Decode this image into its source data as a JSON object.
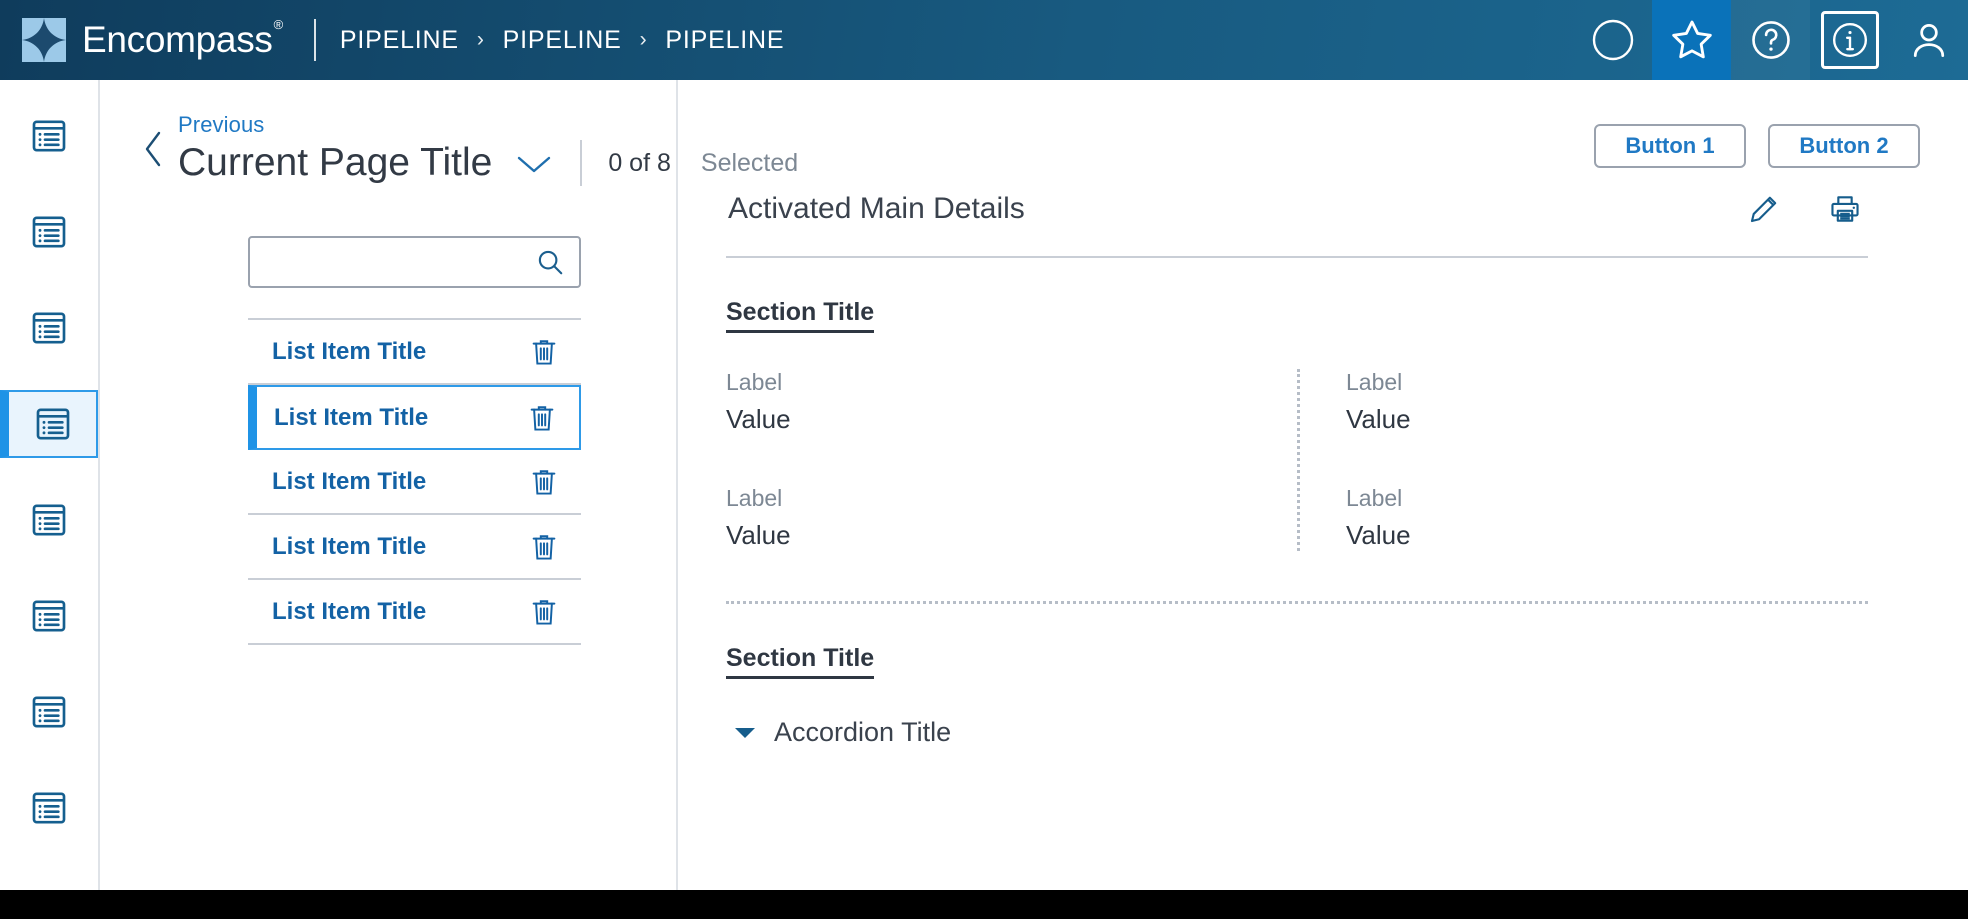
{
  "header": {
    "brand_name": "Encompass",
    "brand_registered": "®",
    "logo_icon": "encompass-star-logo",
    "breadcrumb": [
      "PIPELINE",
      "PIPELINE",
      "PIPELINE"
    ],
    "breadcrumb_separator": "›",
    "icons": [
      {
        "name": "circle-icon",
        "label": "circle"
      },
      {
        "name": "star-icon",
        "label": "star",
        "active": true,
        "accent": "#0a72b9"
      },
      {
        "name": "help-icon",
        "label": "question-mark"
      },
      {
        "name": "info-icon",
        "label": "information",
        "boxed": true
      },
      {
        "name": "user-icon",
        "label": "person"
      }
    ]
  },
  "page": {
    "previous_link": "Previous",
    "title": "Current Page Title",
    "title_caret_icon": "chevron-down-icon",
    "back_icon": "chevron-left-icon",
    "selection_count": "0 of 8",
    "selection_word": "Selected",
    "buttons": [
      {
        "label": "Button 1",
        "name": "button-1"
      },
      {
        "label": "Button 2",
        "name": "button-2"
      }
    ]
  },
  "sidebar": {
    "icon_name": "list-document-icon",
    "active_index": 3,
    "items": [
      {
        "label": "List Document 1"
      },
      {
        "label": "List Document 2"
      },
      {
        "label": "List Document 3"
      },
      {
        "label": "List Document 4"
      },
      {
        "label": "List Document 5"
      },
      {
        "label": "List Document 6"
      },
      {
        "label": "List Document 7"
      },
      {
        "label": "List Document 8"
      }
    ]
  },
  "search": {
    "value": "",
    "placeholder": "",
    "icon": "search-icon"
  },
  "list": {
    "delete_icon": "trash-icon",
    "selected_index": 1,
    "items": [
      {
        "title": "List Item Title"
      },
      {
        "title": "List Item Title"
      },
      {
        "title": "List Item Title"
      },
      {
        "title": "List Item Title"
      },
      {
        "title": "List Item Title"
      }
    ]
  },
  "detail": {
    "title": "Activated Main Details",
    "edit_icon": "pencil-icon",
    "print_icon": "printer-icon",
    "section_one": {
      "title": "Section Title",
      "left": [
        {
          "label": "Label",
          "value": "Value"
        },
        {
          "label": "Label",
          "value": "Value"
        }
      ],
      "right": [
        {
          "label": "Label",
          "value": "Value"
        },
        {
          "label": "Label",
          "value": "Value"
        }
      ]
    },
    "section_two": {
      "title": "Section Title",
      "accordion_title": "Accordion Title",
      "accordion_caret_icon": "caret-down-icon"
    }
  },
  "colors": {
    "header_dark": "#0f3c5c",
    "header_light": "#1d6b95",
    "accent_blue": "#0a72b9",
    "link_blue": "#1362a5",
    "select_blue": "#1f93e6",
    "select_bg": "#e9f4fd",
    "muted_text": "#7d8894",
    "body_text": "#2f3742",
    "border_gray": "#c9ced6"
  }
}
